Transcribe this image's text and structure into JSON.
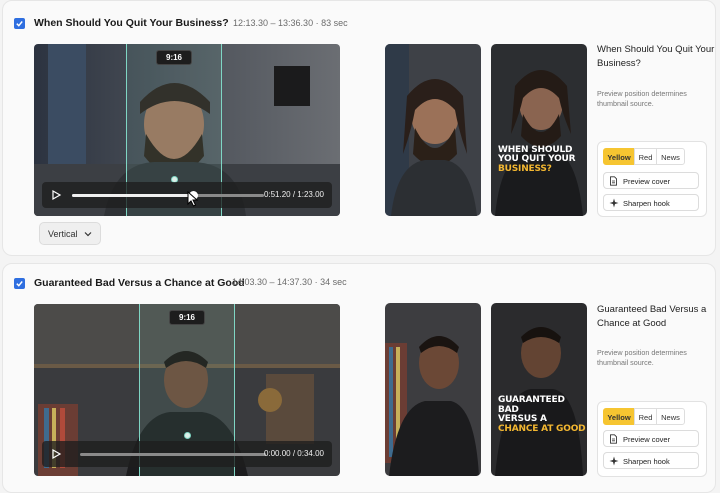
{
  "clips": [
    {
      "selected": true,
      "title": "When Should You Quit Your Business?",
      "time_range": "12:13.30 – 13:36.30 · 83 sec",
      "aspect_tag": "9:16",
      "player_time": "0:51.20 / 1:23.00",
      "progress_fraction": 0.63,
      "format_label": "Vertical",
      "thumbnail_caption": [
        "WHEN SHOULD",
        "YOU QUIT YOUR"
      ],
      "thumbnail_caption_highlight": "BUSINESS?",
      "side_title": "When Should You Quit Your Business?",
      "side_note": "Preview position determines thumbnail source.",
      "styles": [
        "Yellow",
        "Red",
        "News"
      ],
      "active_style": "Yellow",
      "preview_label": "Preview cover",
      "sharpen_label": "Sharpen hook"
    },
    {
      "selected": true,
      "title": "Guaranteed Bad Versus a Chance at Good",
      "time_range": "14:03.30 – 14:37.30 · 34 sec",
      "aspect_tag": "9:16",
      "player_time": "0:00.00 / 0:34.00",
      "progress_fraction": 0.0,
      "thumbnail_caption": [
        "GUARANTEED BAD",
        "VERSUS A"
      ],
      "thumbnail_caption_highlight": "CHANCE AT GOOD",
      "side_title": "Guaranteed Bad Versus a Chance at Good",
      "side_note": "Preview position determines thumbnail source.",
      "styles": [
        "Yellow",
        "Red",
        "News"
      ],
      "active_style": "Yellow",
      "preview_label": "Preview cover",
      "sharpen_label": "Sharpen hook"
    }
  ],
  "colors": {
    "accent_checkbox": "#2f6fe0",
    "active_style": "#f6c531",
    "caption_highlight": "#f3b731",
    "crop_outline": "#7fd6c4"
  }
}
